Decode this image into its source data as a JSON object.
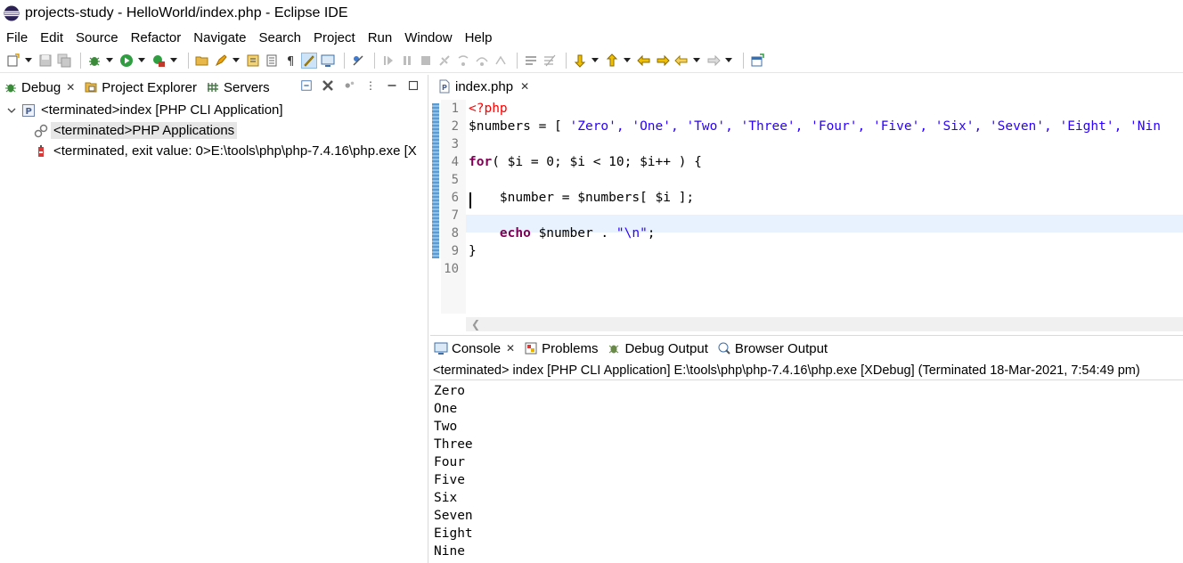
{
  "window": {
    "title": "projects-study - HelloWorld/index.php - Eclipse IDE"
  },
  "menu": [
    "File",
    "Edit",
    "Source",
    "Refactor",
    "Navigate",
    "Search",
    "Project",
    "Run",
    "Window",
    "Help"
  ],
  "left_panel": {
    "tabs": [
      {
        "label": "Debug",
        "icon": "debug-icon",
        "closable": true
      },
      {
        "label": "Project Explorer",
        "icon": "project-explorer-icon",
        "closable": false
      },
      {
        "label": "Servers",
        "icon": "servers-icon",
        "closable": false
      }
    ],
    "tree": [
      {
        "label": "<terminated>index [PHP CLI Application]",
        "icon": "php-launch-icon",
        "level": 0
      },
      {
        "label": "<terminated>PHP Applications",
        "icon": "debug-target-icon",
        "level": 1,
        "selected": true
      },
      {
        "label": "<terminated, exit value: 0>E:\\tools\\php\\php-7.4.16\\php.exe [X",
        "icon": "process-icon",
        "level": 1
      }
    ]
  },
  "editor": {
    "tab_label": "index.php",
    "line_numbers": [
      "1",
      "2",
      "3",
      "4",
      "5",
      "6",
      "7",
      "8",
      "9",
      "10"
    ],
    "lines": {
      "l1": "<?php",
      "l2_var": "$numbers = [ ",
      "l2_items": "'Zero', 'One', 'Two', 'Three', 'Four', 'Five', 'Six', 'Seven', 'Eight', 'Nin",
      "l4_kw": "for",
      "l4_rest": "( $i = 0; $i < 10; $i++ ) {",
      "l6": "    $number = $numbers[ $i ];",
      "l8_indent": "    ",
      "l8_kw": "echo",
      "l8_mid": " $number . ",
      "l8_str": "\"\\n\"",
      "l8_end": ";",
      "l9": "}"
    }
  },
  "console": {
    "tabs": [
      {
        "label": "Console",
        "icon": "console-icon",
        "closable": true
      },
      {
        "label": "Problems",
        "icon": "problems-icon",
        "closable": false
      },
      {
        "label": "Debug Output",
        "icon": "debug-output-icon",
        "closable": false
      },
      {
        "label": "Browser Output",
        "icon": "browser-output-icon",
        "closable": false
      }
    ],
    "description": "<terminated> index [PHP CLI Application] E:\\tools\\php\\php-7.4.16\\php.exe [XDebug] (Terminated 18-Mar-2021, 7:54:49 pm)",
    "output": [
      "Zero",
      "One",
      "Two",
      "Three",
      "Four",
      "Five",
      "Six",
      "Seven",
      "Eight",
      "Nine"
    ]
  }
}
